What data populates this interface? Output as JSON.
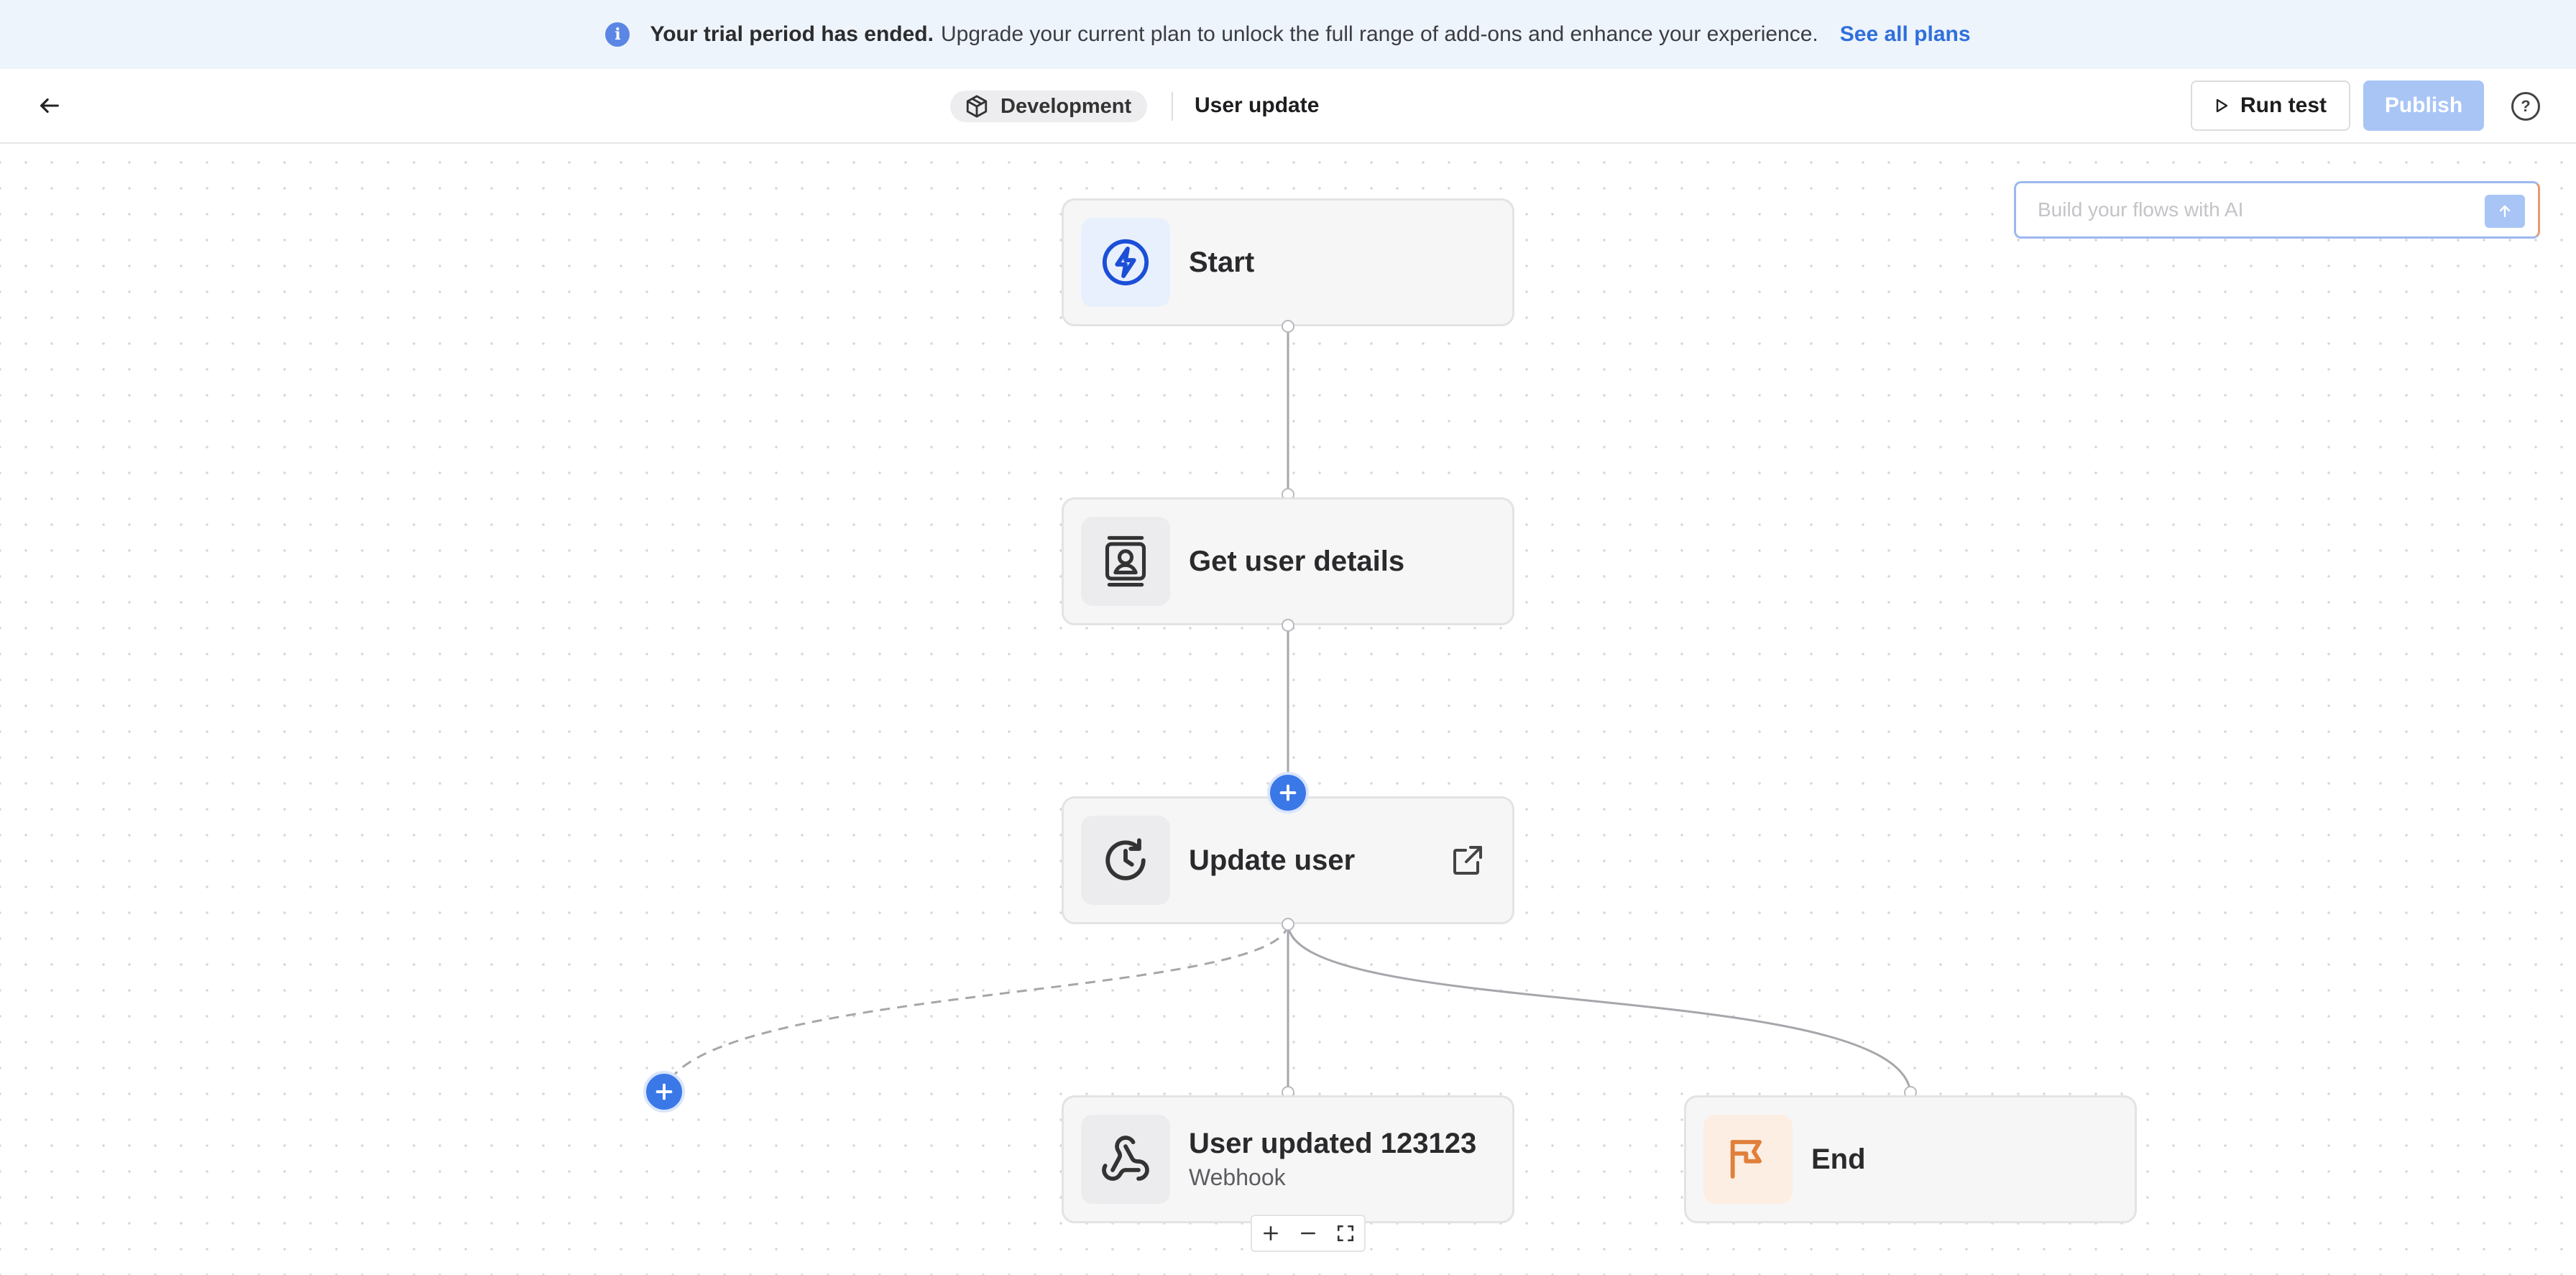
{
  "banner": {
    "title": "Your trial period has ended.",
    "message": "Upgrade your current plan to unlock the full range of add-ons and enhance your experience.",
    "link": "See all plans",
    "icon": "info-icon"
  },
  "header": {
    "environment": "Development",
    "flow_name": "User update",
    "run_test_label": "Run test",
    "publish_label": "Publish",
    "help_icon": "question-circle-icon"
  },
  "ai_prompt": {
    "placeholder": "Build your flows with AI"
  },
  "nodes": [
    {
      "title": "Start",
      "icon": "lightning-icon"
    },
    {
      "title": "Get user details",
      "icon": "contact-card-icon"
    },
    {
      "title": "Update user",
      "icon": "refresh-clock-icon"
    },
    {
      "title": "User updated 123123",
      "subtitle": "Webhook",
      "icon": "webhook-icon"
    },
    {
      "title": "End",
      "icon": "flag-icon"
    }
  ],
  "colors": {
    "accent": "#3b78e7",
    "publish_disabled": "#a9c5f6",
    "banner_bg": "#eef4fb",
    "start_icon": "#1b4fd8",
    "end_icon": "#e0803a"
  }
}
